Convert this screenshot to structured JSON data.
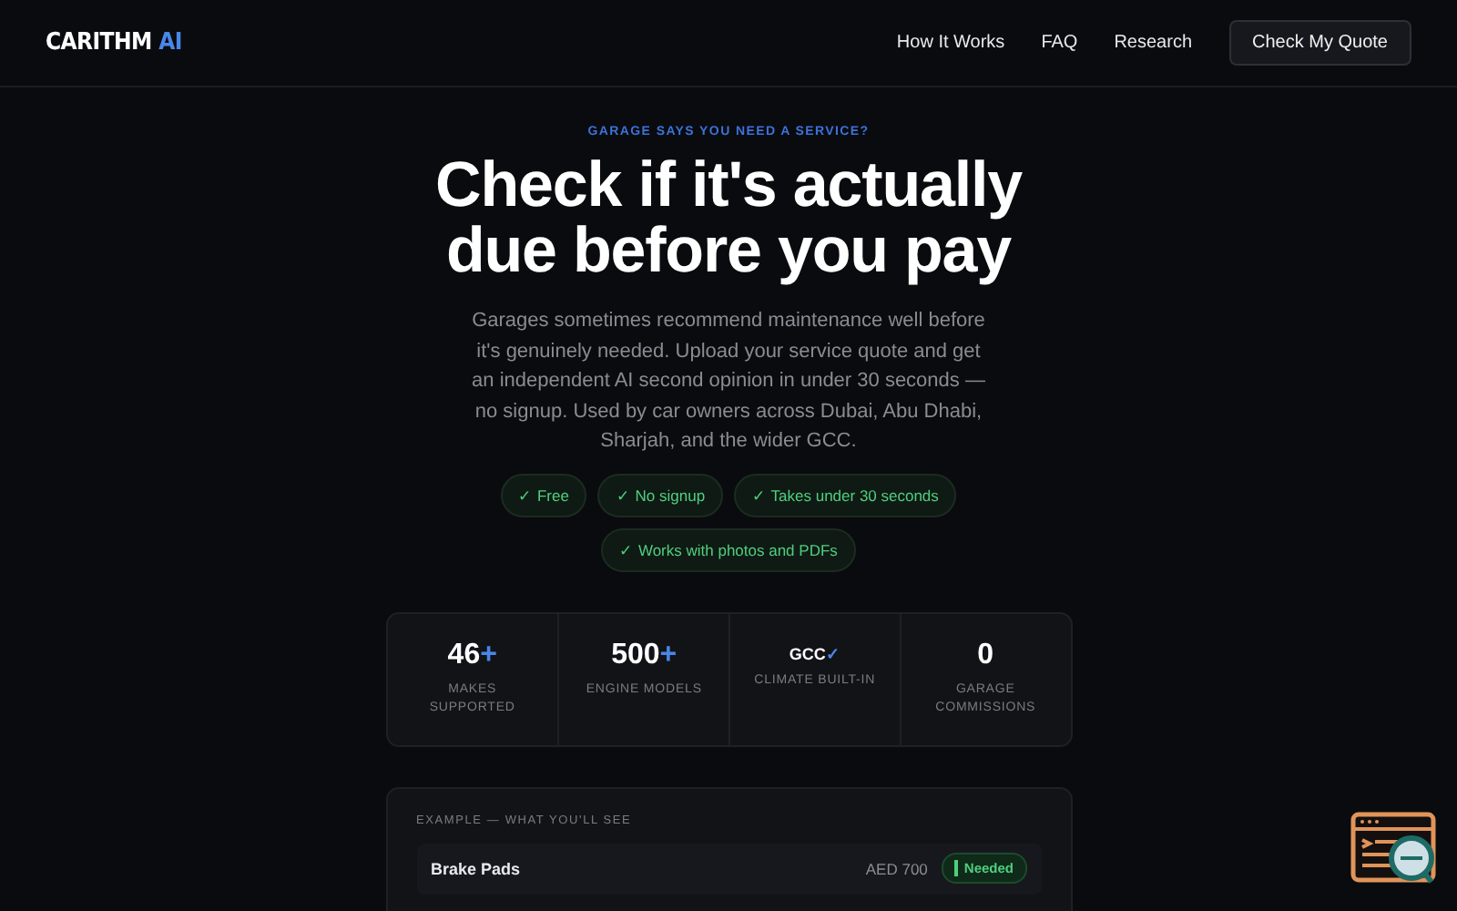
{
  "header": {
    "logo": "CARITHM",
    "logo_accent": "AI",
    "nav": [
      "How It Works",
      "FAQ",
      "Research"
    ],
    "cta": "Check My Quote"
  },
  "hero": {
    "eyebrow": "GARAGE SAYS YOU NEED A SERVICE?",
    "title": "Check if it's actually due before you pay",
    "lead": "Garages sometimes recommend maintenance well before it's genuinely needed. Upload your service quote and get an independent AI second opinion in under 30 seconds — no signup. Used by car owners across Dubai, Abu Dhabi, Sharjah, and the wider GCC.",
    "pills": [
      "✓ Free",
      "✓ No signup",
      "✓ Takes under 30 seconds",
      "✓ Works with photos and PDFs"
    ]
  },
  "stats": [
    {
      "value": "46",
      "suffix": "+",
      "label": "MAKES SUPPORTED",
      "kind": "number"
    },
    {
      "value": "500",
      "suffix": "+",
      "label": "ENGINE MODELS",
      "kind": "number"
    },
    {
      "value": "GCC",
      "suffix": "✓",
      "label": "CLIMATE BUILT-IN",
      "kind": "text"
    },
    {
      "value": "0",
      "label": "GARAGE COMMISSIONS",
      "kind": "number"
    }
  ],
  "example": {
    "heading": "EXAMPLE — WHAT YOU'LL SEE",
    "rows": [
      {
        "item": "Brake Pads",
        "price": "AED 700",
        "status": "Needed",
        "kind": "needed"
      }
    ]
  }
}
